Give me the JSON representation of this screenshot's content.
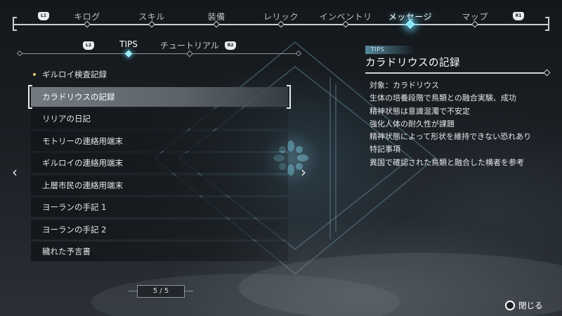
{
  "top_tabs": [
    "キログ",
    "スキル",
    "装備",
    "レリック",
    "インベントリ",
    "メッセージ",
    "マップ"
  ],
  "top_active": "メッセージ",
  "shoulder_left_top": "L1",
  "shoulder_right_top": "R1",
  "sub_tabs": [
    "TIPS",
    "チュートリアル"
  ],
  "sub_active": "TIPS",
  "shoulder_left_sub": "L2",
  "shoulder_right_sub": "R2",
  "list_items": [
    {
      "label": "ギルロイ検査記録",
      "new": true
    },
    {
      "label": "カラドリウスの記録",
      "selected": true
    },
    {
      "label": "リリアの日記"
    },
    {
      "label": "モトリーの連絡用端末"
    },
    {
      "label": "ギルロイの連絡用端末"
    },
    {
      "label": "上層市民の連絡用端末"
    },
    {
      "label": "ヨーランの手記 1"
    },
    {
      "label": "ヨーランの手記 2"
    },
    {
      "label": "穢れた予言書"
    }
  ],
  "page_indicator": "5 / 5",
  "detail": {
    "category": "TIPS",
    "title": "カラドリウスの記録",
    "lines": [
      "対象：カラドリウス",
      "生体の培養段階で鳥類との融合実験、成功",
      "精神状態は意識混濁で不安定",
      "強化人体の耐久性が課題",
      "精神状態によって形状を維持できない恐れあり",
      "特記事項",
      "異国で確認された鳥類と融合した横者を参考"
    ]
  },
  "close_label": "閉じる",
  "colors": {
    "accent": "#7fe6ff",
    "selected_row": "#78808a",
    "new_dot": "#e8c37a"
  }
}
